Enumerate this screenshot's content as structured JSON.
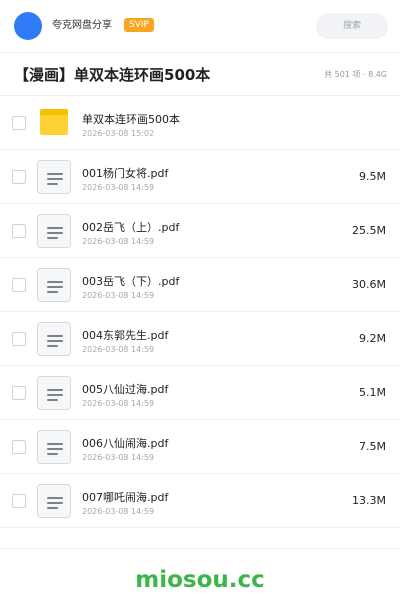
{
  "header": {
    "username": "夸克网盘分享",
    "badge": "SVIP",
    "search_label": "搜索"
  },
  "folder": {
    "title": "【漫画】单双本连环画500本",
    "meta": "共 501 项 · 8.4G"
  },
  "items": [
    {
      "type": "folder",
      "name": "单双本连环画500本",
      "date": "2026-03-08 15:02",
      "size": ""
    },
    {
      "type": "pdf",
      "name": "001杨门女将.pdf",
      "date": "2026-03-08 14:59",
      "size": "9.5M"
    },
    {
      "type": "pdf",
      "name": "002岳飞（上）.pdf",
      "date": "2026-03-08 14:59",
      "size": "25.5M"
    },
    {
      "type": "pdf",
      "name": "003岳飞（下）.pdf",
      "date": "2026-03-08 14:59",
      "size": "30.6M"
    },
    {
      "type": "pdf",
      "name": "004东郭先生.pdf",
      "date": "2026-03-08 14:59",
      "size": "9.2M"
    },
    {
      "type": "pdf",
      "name": "005八仙过海.pdf",
      "date": "2026-03-08 14:59",
      "size": "5.1M"
    },
    {
      "type": "pdf",
      "name": "006八仙闹海.pdf",
      "date": "2026-03-08 14:59",
      "size": "7.5M"
    },
    {
      "type": "pdf",
      "name": "007哪吒闹海.pdf",
      "date": "2026-03-08 14:59",
      "size": "13.3M"
    }
  ],
  "footer": {
    "watermark": "miosou.cc"
  },
  "colors": {
    "accent": "#2f7cf6",
    "badge": "#f6a623",
    "folder": "#ffd233",
    "watermark": "#3cb54a"
  },
  "icons": {
    "folder": "folder-icon",
    "pdf": "document-icon"
  }
}
